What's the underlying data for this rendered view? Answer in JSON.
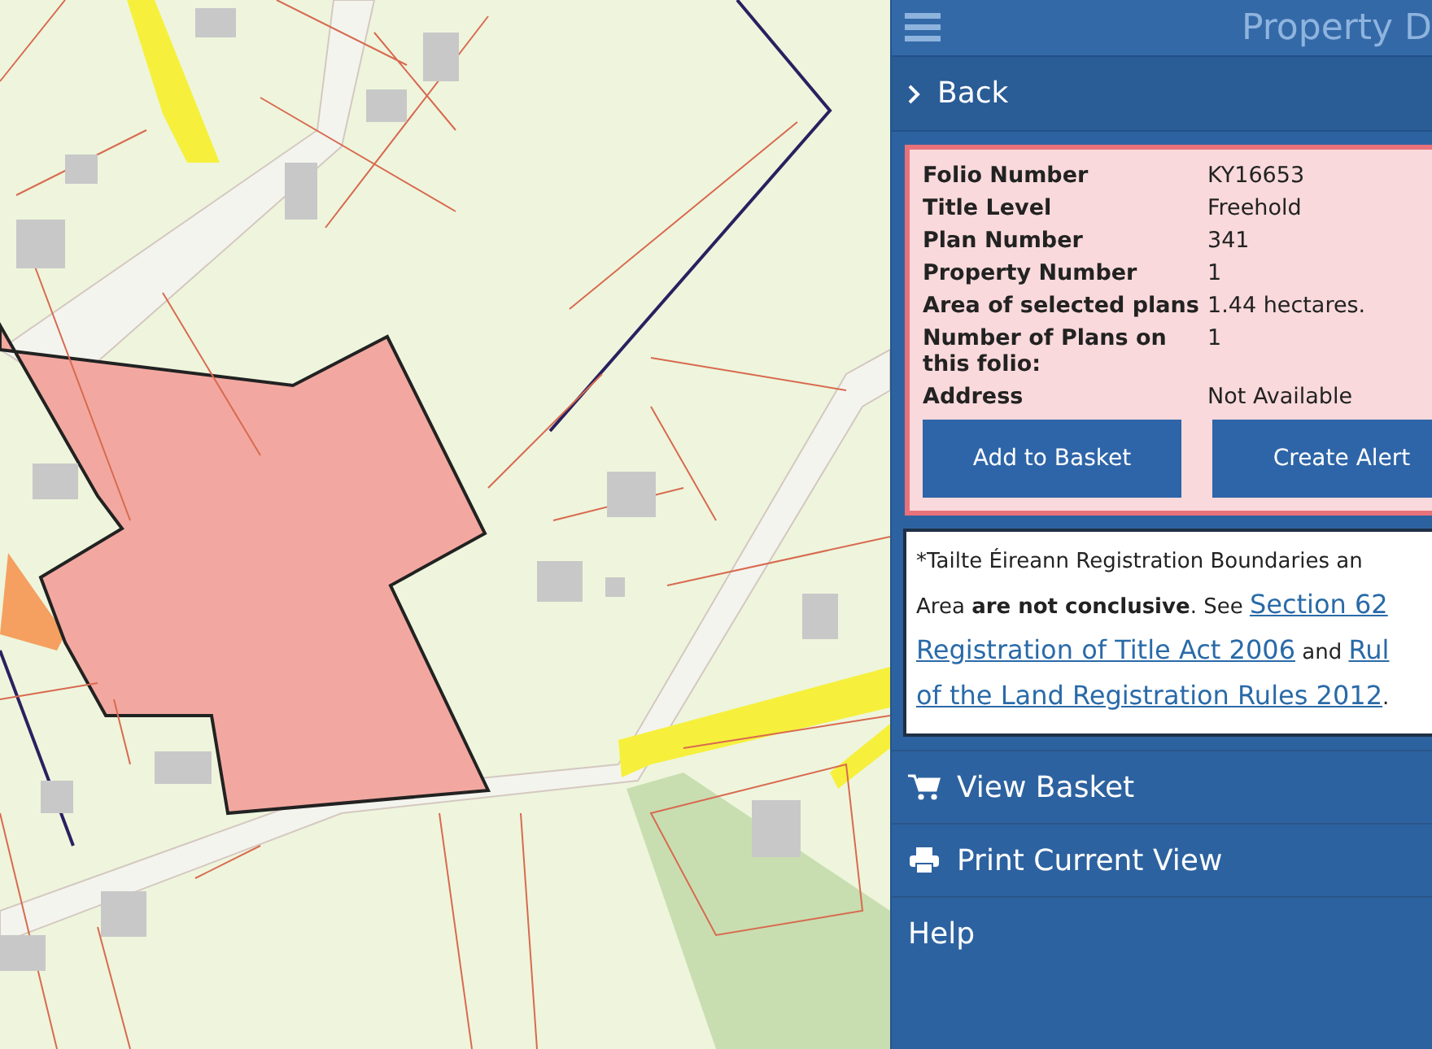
{
  "header": {
    "title": "Property D"
  },
  "back": {
    "label": "Back"
  },
  "details": [
    {
      "label": "Folio Number",
      "value": "KY16653"
    },
    {
      "label": "Title Level",
      "value": "Freehold"
    },
    {
      "label": "Plan Number",
      "value": "341"
    },
    {
      "label": "Property Number",
      "value": "1"
    },
    {
      "label": "Area of selected plans",
      "value": "1.44 hectares."
    },
    {
      "label": "Number of Plans on this folio:",
      "value": "1"
    },
    {
      "label": "Address",
      "value": "Not Available"
    }
  ],
  "actions": [
    "Add to Basket",
    "Create Alert"
  ],
  "disclaimer": [
    [
      {
        "kind": "text",
        "text": "*Tailte Éireann Registration Boundaries an"
      }
    ],
    [
      {
        "kind": "text",
        "text": "Area **are not conclusive**. See "
      },
      {
        "kind": "link",
        "text": "Section 62"
      }
    ],
    [
      {
        "kind": "link",
        "text": "Registration of Title Act 2006"
      },
      {
        "kind": "text",
        "text": " and "
      },
      {
        "kind": "link",
        "text": "Rul"
      }
    ],
    [
      {
        "kind": "link",
        "text": "of the Land Registration Rules 2012"
      },
      {
        "kind": "text",
        "text": "."
      }
    ]
  ],
  "menu": [
    {
      "kind": "cart",
      "label": "View Basket"
    },
    {
      "kind": "print",
      "label": "Print Current View"
    },
    {
      "kind": "none",
      "label": "Help"
    }
  ]
}
